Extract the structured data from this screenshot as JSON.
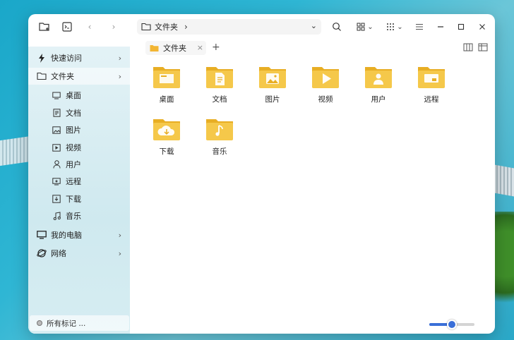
{
  "address_bar": {
    "folder_name": "文件夹",
    "separator": "›"
  },
  "sidebar": {
    "quick_access": "快速访问",
    "folder": "文件夹",
    "items": [
      {
        "label": "桌面",
        "icon": "desktop-icon"
      },
      {
        "label": "文档",
        "icon": "document-icon"
      },
      {
        "label": "图片",
        "icon": "picture-icon"
      },
      {
        "label": "视频",
        "icon": "video-icon"
      },
      {
        "label": "用户",
        "icon": "user-icon"
      },
      {
        "label": "远程",
        "icon": "remote-icon"
      },
      {
        "label": "下载",
        "icon": "download-icon"
      },
      {
        "label": "音乐",
        "icon": "music-icon"
      }
    ],
    "my_computer": "我的电脑",
    "network": "网络",
    "all_tags": "所有标记 ..."
  },
  "tab": {
    "label": "文件夹"
  },
  "files": [
    {
      "label": "桌面",
      "icon": "desktop-folder-icon"
    },
    {
      "label": "文档",
      "icon": "document-folder-icon"
    },
    {
      "label": "图片",
      "icon": "picture-folder-icon"
    },
    {
      "label": "视频",
      "icon": "video-folder-icon"
    },
    {
      "label": "用户",
      "icon": "user-folder-icon"
    },
    {
      "label": "远程",
      "icon": "remote-folder-icon"
    },
    {
      "label": "下载",
      "icon": "download-folder-icon"
    },
    {
      "label": "音乐",
      "icon": "music-folder-icon"
    }
  ],
  "zoom_level": 0.5,
  "colors": {
    "folder": "#f5c84a",
    "folder_dark": "#e8ae24",
    "accent": "#3a6fd8"
  }
}
